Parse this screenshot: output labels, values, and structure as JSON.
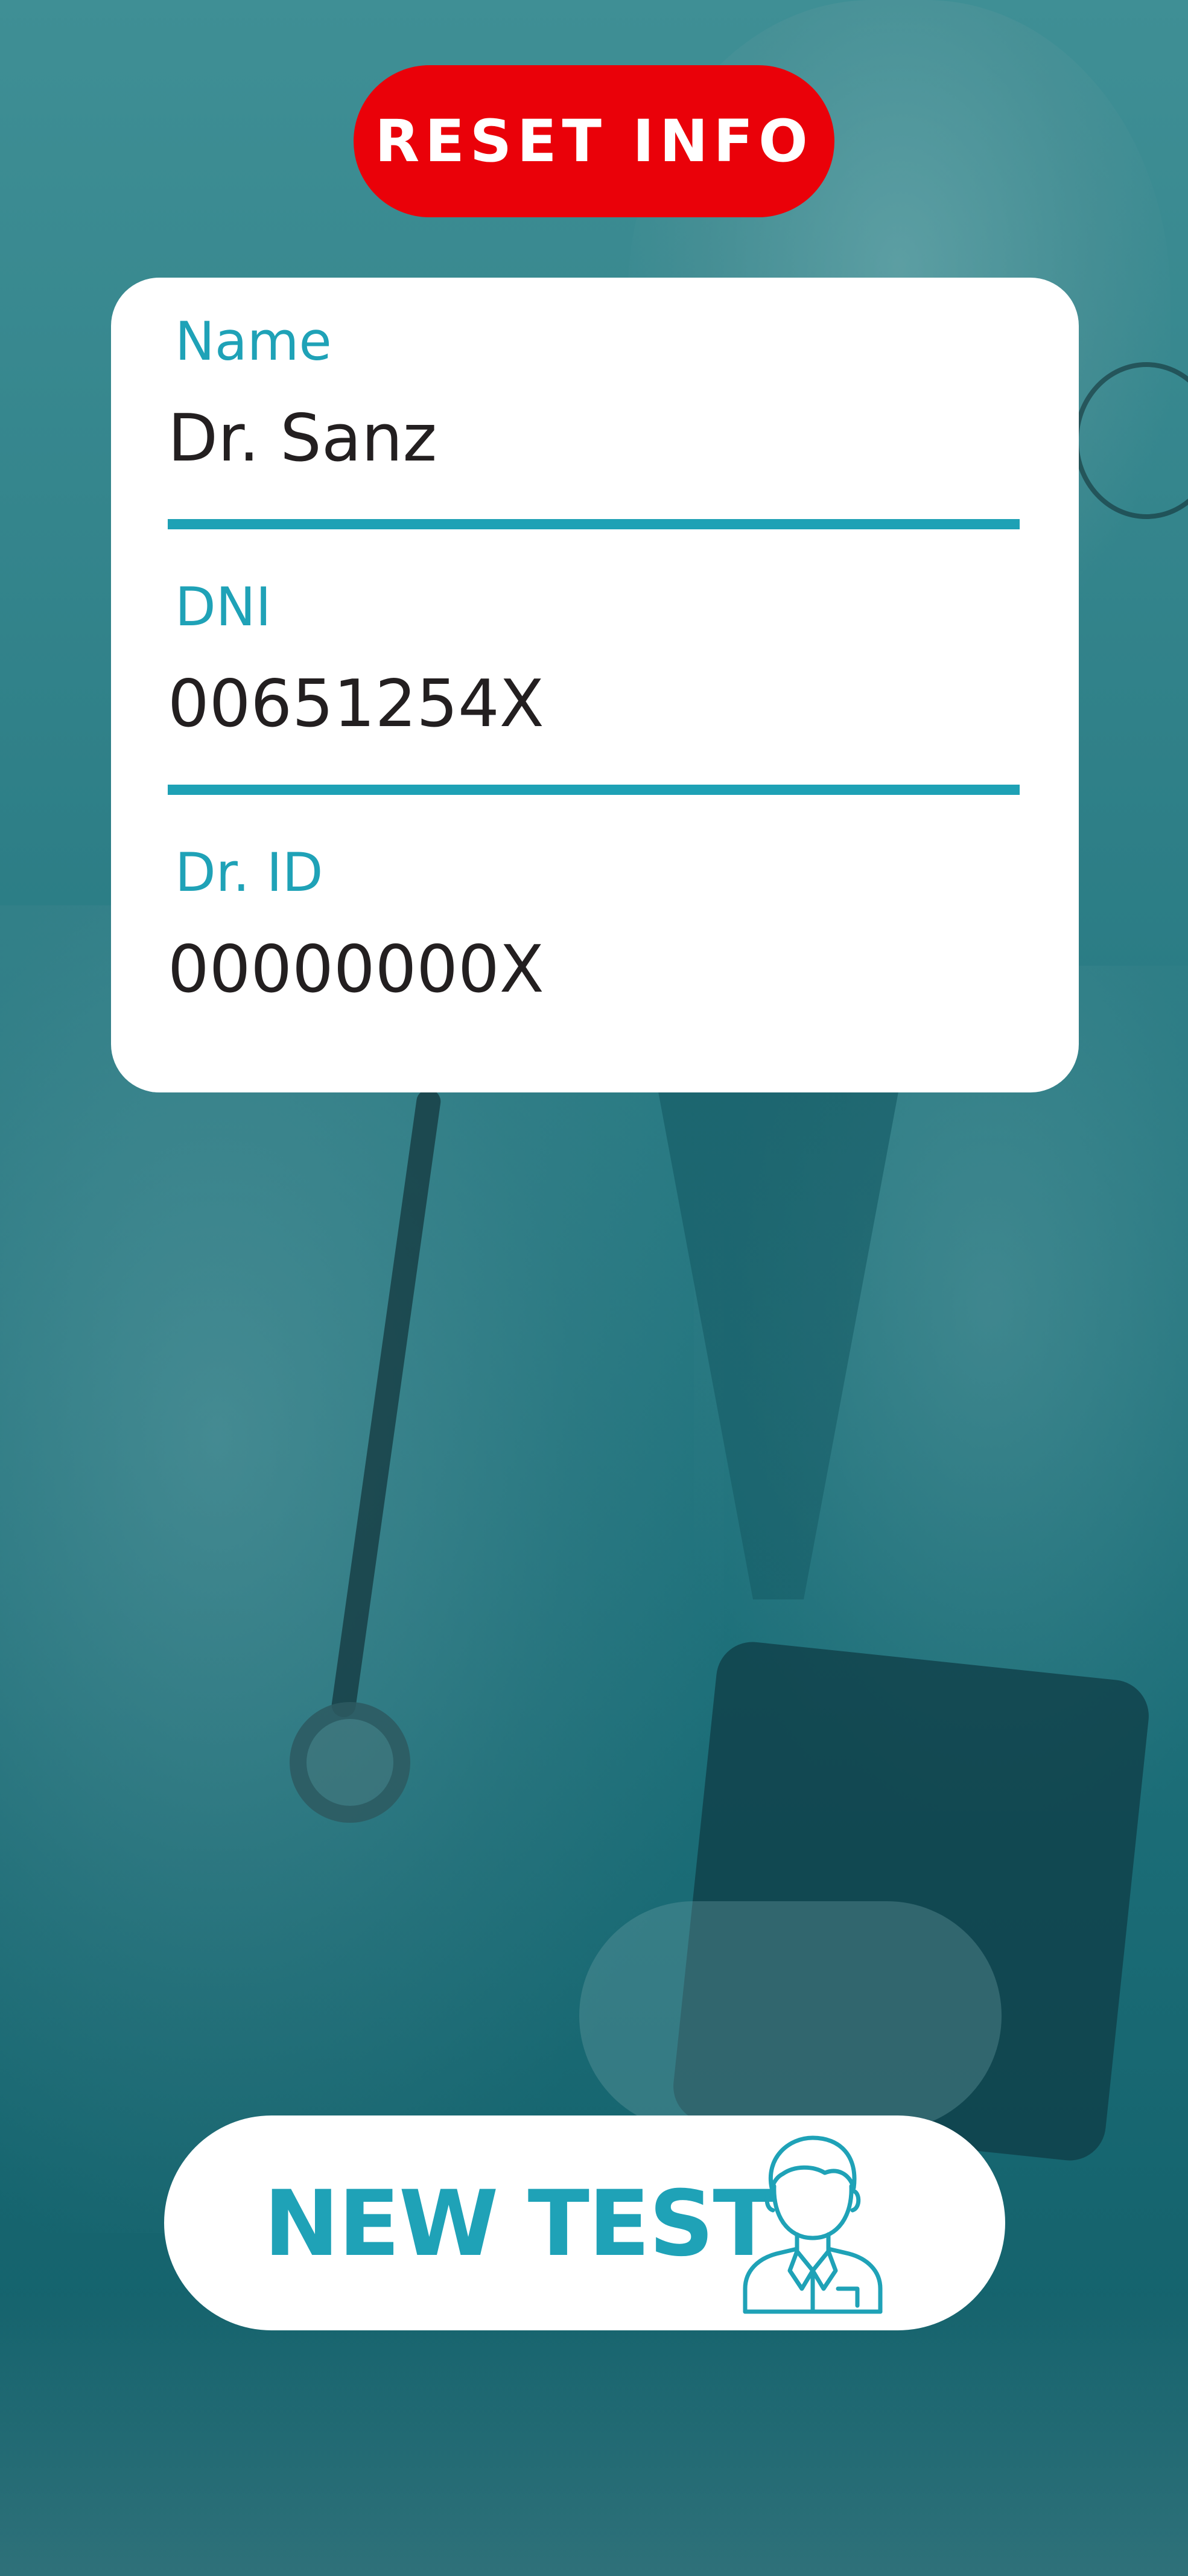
{
  "header": {
    "reset_label": "RESET INFO"
  },
  "form": {
    "name": {
      "label": "Name",
      "value": "Dr. Sanz"
    },
    "dni": {
      "label": "DNI",
      "value": "00651254X"
    },
    "dr_id": {
      "label": "Dr. ID",
      "value": "00000000X"
    }
  },
  "footer": {
    "new_test_label": "NEW TEST",
    "icon": "doctor-icon"
  },
  "colors": {
    "accent": "#1fa2b7",
    "reset": "#ea0109",
    "background": "#2f8088"
  }
}
